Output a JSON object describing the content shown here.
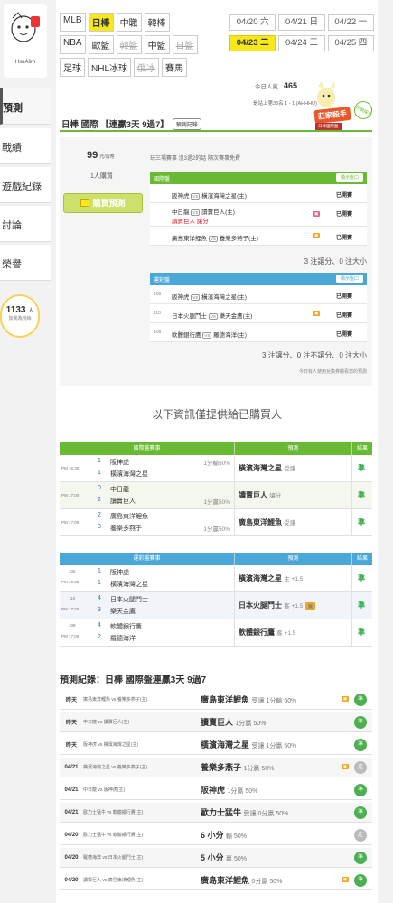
{
  "sidebar": {
    "avatar_name": "HsuAlim",
    "items": [
      {
        "label": "預測"
      },
      {
        "label": "戰績"
      },
      {
        "label": "遊戲紀錄"
      },
      {
        "label": "討論"
      },
      {
        "label": "榮譽"
      }
    ],
    "bulb": {
      "count": "1133",
      "unit": "人",
      "sub": "加我為粉絲"
    }
  },
  "categories": {
    "row1": [
      "MLB",
      "日棒",
      "中職",
      "韓棒"
    ],
    "row2": [
      "NBA",
      "歐籃",
      "韓籃",
      "中籃",
      "日籃"
    ],
    "row3": [
      "足球",
      "NHL冰球",
      "俄冰",
      "賽馬"
    ],
    "active": "日棒"
  },
  "dates": [
    "04/20 六",
    "04/21 日",
    "04/22 一",
    "04/23 二",
    "04/24 三",
    "04/25 四"
  ],
  "active_date": "04/23 二",
  "popularity": {
    "label": "今日人氣",
    "value": "465"
  },
  "rank_text": "是站上第33名 1 - 1 (AHHHU)",
  "badge": {
    "label": "莊家殺手",
    "sub": "日棒國際盤",
    "star": "名偵探手"
  },
  "title": {
    "text": "日棒 國際 【連贏3天 9過7】",
    "tag": "預測記錄"
  },
  "purchase": {
    "price": "99",
    "price_unit": "元/週幣",
    "buyers": "1人購買",
    "buy_label": "購買預測",
    "promo": "玩三場賽事 沒3過2的話 隔次賽事免費"
  },
  "intl": {
    "header": "國際盤",
    "opener": "顯示盤口",
    "rows": [
      {
        "home": "阪神虎",
        "away": "橫濱海灣之星(主)",
        "status": "已開賽"
      },
      {
        "home": "中日龍",
        "away": "讀賣巨人(主)",
        "line2": "讀賣巨人 讓分",
        "status": "已開賽"
      },
      {
        "home": "廣島東洋鯉魚",
        "away": "養樂多燕子(主)",
        "status": "已開賽"
      }
    ],
    "total": "3 注讓分、0 注大小"
  },
  "lottery": {
    "header": "運彩盤",
    "opener": "顯示盤口",
    "rows": [
      {
        "code": "106",
        "home": "阪神虎",
        "away": "橫濱海灣之星(主)",
        "status": "已開賽"
      },
      {
        "code": "110",
        "home": "日本火腿鬥士",
        "away": "樂天金鷹(主)",
        "status": "已開賽"
      },
      {
        "code": "108",
        "home": "軟體銀行鷹",
        "away": "羅德海洋(主)",
        "status": "已開賽"
      }
    ],
    "total": "3 注讓分、0 注不讓分、0 注大小",
    "note": "今日有人使用兌換券觀看您的預測"
  },
  "info_text": "以下資訊僅提供給已購買人",
  "table1": {
    "headers": [
      "國際盤賽事",
      "預測",
      "結果"
    ],
    "rows": [
      {
        "time": "PM 16:30",
        "s1": "1",
        "t1": "阪神虎",
        "s2": "1",
        "t2": "橫濱海灣之星",
        "odds": "1分輸50%",
        "pick": "橫濱海灣之星",
        "pnote": "受讓",
        "res": "準"
      },
      {
        "time": "PM 17:00",
        "s1": "0",
        "t1": "中日龍",
        "s2": "2",
        "t2": "讀賣巨人",
        "odds": "1分贏50%",
        "pick": "讀賣巨人",
        "pnote": "讓分",
        "res": "準"
      },
      {
        "time": "PM 17:00",
        "s1": "2",
        "t1": "廣島東洋鯉魚",
        "s2": "0",
        "t2": "養樂多燕子",
        "odds": "1分贏50%",
        "pick": "廣島東洋鯉魚",
        "pnote": "受讓",
        "res": "準"
      }
    ]
  },
  "table2": {
    "headers": [
      "運彩盤賽事",
      "預測",
      "結果"
    ],
    "rows": [
      {
        "code": "106",
        "time": "PM 16:30",
        "s1": "1",
        "t1": "阪神虎",
        "s2": "1",
        "t2": "橫濱海灣之星",
        "pick": "橫濱海灣之星",
        "pnote": "主 +1.5",
        "res": "準"
      },
      {
        "code": "110",
        "time": "PM 17:00",
        "s1": "4",
        "t1": "日本火腿鬥士",
        "s2": "3",
        "t2": "樂天金鷹",
        "pick": "日本火腿鬥士",
        "pnote": "客 +1.5",
        "res": "準"
      },
      {
        "code": "108",
        "time": "PM 17:00",
        "s1": "4",
        "t1": "軟體銀行鷹",
        "s2": "2",
        "t2": "羅德海洋",
        "pick": "軟體銀行鷹",
        "pnote": "客 +1.5",
        "res": "準"
      }
    ]
  },
  "records": {
    "title": "預測紀錄：日棒 國際盤連贏3天 9過7",
    "rows": [
      {
        "d": "昨天",
        "m": "廣島東洋鯉魚 vs 養樂多燕子(主)",
        "pick": "廣島東洋鯉魚",
        "note": "受讓 1分輸 50%",
        "res": "準"
      },
      {
        "d": "昨天",
        "m": "中日龍 vs 讀賣巨人(主)",
        "pick": "讀賣巨人",
        "note": "1分贏 50%",
        "res": "準"
      },
      {
        "d": "昨天",
        "m": "阪神虎 vs 橫濱海灣之星(主)",
        "pick": "橫濱海灣之星",
        "note": "受讓 1分贏 50%",
        "res": "準"
      },
      {
        "d": "04/21",
        "m": "橫濱海灣之星 vs 養樂多燕子(主)",
        "pick": "養樂多燕子",
        "note": "1分贏 50%",
        "res": "走"
      },
      {
        "d": "04/21",
        "m": "中日龍 vs 阪神虎(主)",
        "pick": "阪神虎",
        "note": "1分贏 50%",
        "res": "準"
      },
      {
        "d": "04/21",
        "m": "歐力士猛牛 vs 軟體銀行鷹(主)",
        "pick": "歐力士猛牛",
        "note": "受讓 0分贏 50%",
        "res": "準"
      },
      {
        "d": "04/20",
        "m": "歐力士猛牛 vs 軟體銀行鷹(主)",
        "pick": "6 小分",
        "note": "輸 50%",
        "res": "走"
      },
      {
        "d": "04/20",
        "m": "羅德海洋 vs 日本火腿鬥士(主)",
        "pick": "5 小分",
        "note": "贏 50%",
        "res": "準"
      },
      {
        "d": "04/20",
        "m": "讀賣巨人 vs 廣島東洋鯉魚(主)",
        "pick": "廣島東洋鯉魚",
        "note": "0分贏 50%",
        "res": "準"
      }
    ]
  }
}
